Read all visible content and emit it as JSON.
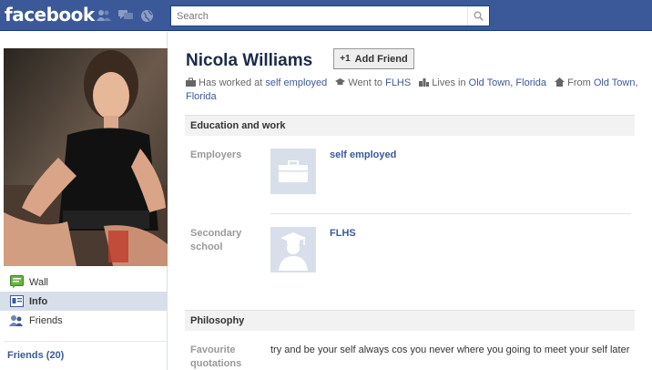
{
  "header": {
    "logo": "facebook",
    "search_placeholder": "Search"
  },
  "colors": {
    "brand_blue": "#3b5998",
    "link": "#3b5998",
    "nav_active": "#d8dfea",
    "section_bg": "#f2f2f2"
  },
  "sidebar": {
    "nav": [
      {
        "label": "Wall",
        "icon": "wall-icon"
      },
      {
        "label": "Info",
        "icon": "info-icon",
        "active": true
      },
      {
        "label": "Friends",
        "icon": "friends-icon"
      }
    ],
    "friends_link": "Friends (20)"
  },
  "profile": {
    "name": "Nicola Williams",
    "add_friend_label": "Add Friend",
    "facts": {
      "worked_prefix": "Has worked at",
      "worked_value": "self employed",
      "went_prefix": "Went to",
      "went_value": "FLHS",
      "lives_prefix": "Lives in",
      "lives_value": "Old Town, Florida",
      "from_prefix": "From",
      "from_value_1": "Old Town,",
      "from_value_2": "Florida"
    }
  },
  "education_work": {
    "title": "Education and work",
    "employers_label": "Employers",
    "employer": "self employed",
    "secondary_label_1": "Secondary",
    "secondary_label_2": "school",
    "school": "FLHS"
  },
  "philosophy": {
    "title": "Philosophy",
    "quotations_label_1": "Favourite",
    "quotations_label_2": "quotations",
    "quote": "try and be your self always cos you never where you going to meet your self later"
  }
}
